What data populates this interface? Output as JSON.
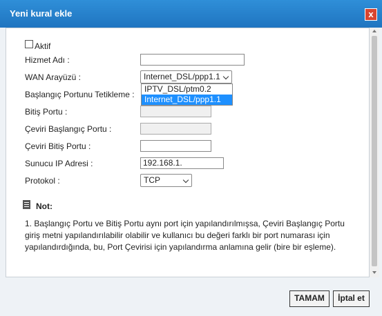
{
  "dialog": {
    "title": "Yeni kural ekle",
    "close_symbol": "x"
  },
  "form": {
    "aktif_label": "Aktif",
    "service_name_label": "Hizmet Adı :",
    "service_name_value": "",
    "wan_label": "WAN Arayüzü :",
    "wan_selected": "Internet_DSL/ppp1.1",
    "wan_options": [
      "IPTV_DSL/ptm0.2",
      "Internet_DSL/ppp1.1"
    ],
    "start_port_label": "Başlangıç Portunu Tetikleme :",
    "end_port_label": "Bitiş Portu :",
    "trans_start_label": "Çeviri Başlangıç Portu :",
    "trans_end_label": "Çeviri Bitiş Portu :",
    "server_ip_label": "Sunucu IP Adresi :",
    "server_ip_value": "192.168.1.",
    "protocol_label": "Protokol :",
    "protocol_selected": "TCP"
  },
  "note": {
    "title": "Not:",
    "text": "1.   Başlangıç Portu ve Bitiş Portu aynı port için yapılandırılmışsa, Çeviri Başlangıç Portu giriş metni yapılandırılabilir olabilir ve kullanıcı bu değeri farklı bir port numarası için yapılandırdığında, bu, Port Çevirisi için yapılandırma anlamına gelir (bire bir eşleme)."
  },
  "buttons": {
    "ok": "TAMAM",
    "cancel": "İptal et"
  },
  "colors": {
    "title_bar": "#1f74c0",
    "close_button": "#d94530",
    "selected_option": "#1e90ff"
  }
}
